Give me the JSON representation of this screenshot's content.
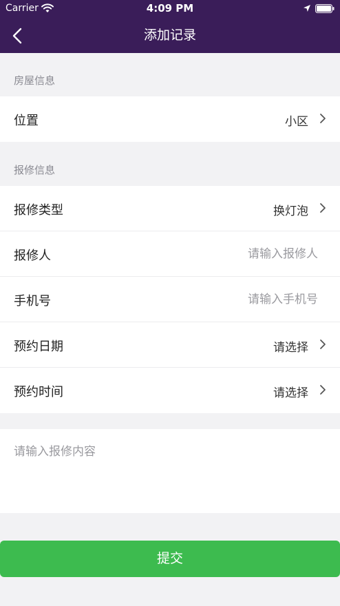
{
  "status_bar": {
    "carrier": "Carrier",
    "time": "4:09 PM"
  },
  "nav": {
    "title": "添加记录",
    "back_icon": "chevron-left-icon"
  },
  "house_section": {
    "label": "房屋信息",
    "rows": [
      {
        "label": "位置",
        "value": "小区"
      }
    ]
  },
  "repair_section": {
    "label": "报修信息",
    "type": {
      "label": "报修类型",
      "value": "换灯泡"
    },
    "reporter": {
      "label": "报修人",
      "placeholder": "请输入报修人",
      "value": ""
    },
    "phone": {
      "label": "手机号",
      "placeholder": "请输入手机号",
      "value": ""
    },
    "date": {
      "label": "预约日期",
      "value": "请选择"
    },
    "time": {
      "label": "预约时间",
      "value": "请选择"
    }
  },
  "content": {
    "placeholder": "请输入报修内容",
    "value": ""
  },
  "submit": {
    "label": "提交"
  },
  "colors": {
    "header_bg": "#3a1d59",
    "submit_bg": "#3dbb4f",
    "page_bg": "#f2f2f4"
  }
}
